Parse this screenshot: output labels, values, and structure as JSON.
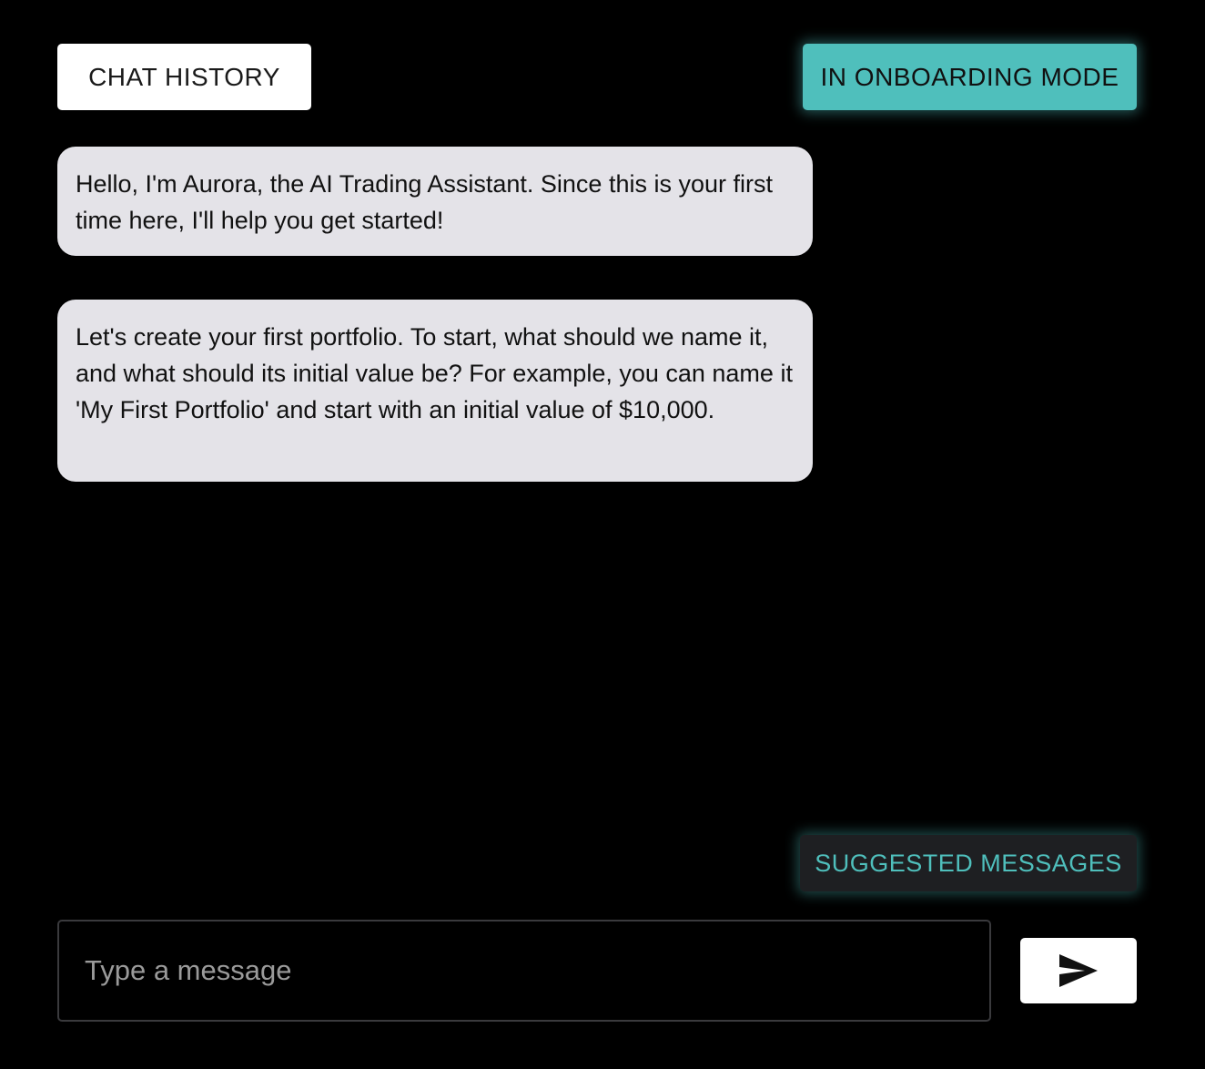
{
  "header": {
    "history_label": "CHAT HISTORY",
    "mode_label": "IN ONBOARDING MODE"
  },
  "messages": [
    {
      "sender": "assistant",
      "text": "Hello, I'm Aurora, the AI Trading Assistant. Since this is your first time here, I'll help you get started!"
    },
    {
      "sender": "assistant",
      "text": "Let's create your first portfolio. To start, what should we name it, and what should its initial value be? For example, you can name it 'My First Portfolio' and start with an initial value of $10,000."
    }
  ],
  "suggested": {
    "label": "SUGGESTED MESSAGES"
  },
  "composer": {
    "placeholder": "Type a message",
    "value": "",
    "send_icon": "send-icon"
  },
  "colors": {
    "background": "#000000",
    "accent": "#4fbfbc",
    "bubble": "#e4e3e8",
    "suggested_bg": "#1e1f22"
  }
}
